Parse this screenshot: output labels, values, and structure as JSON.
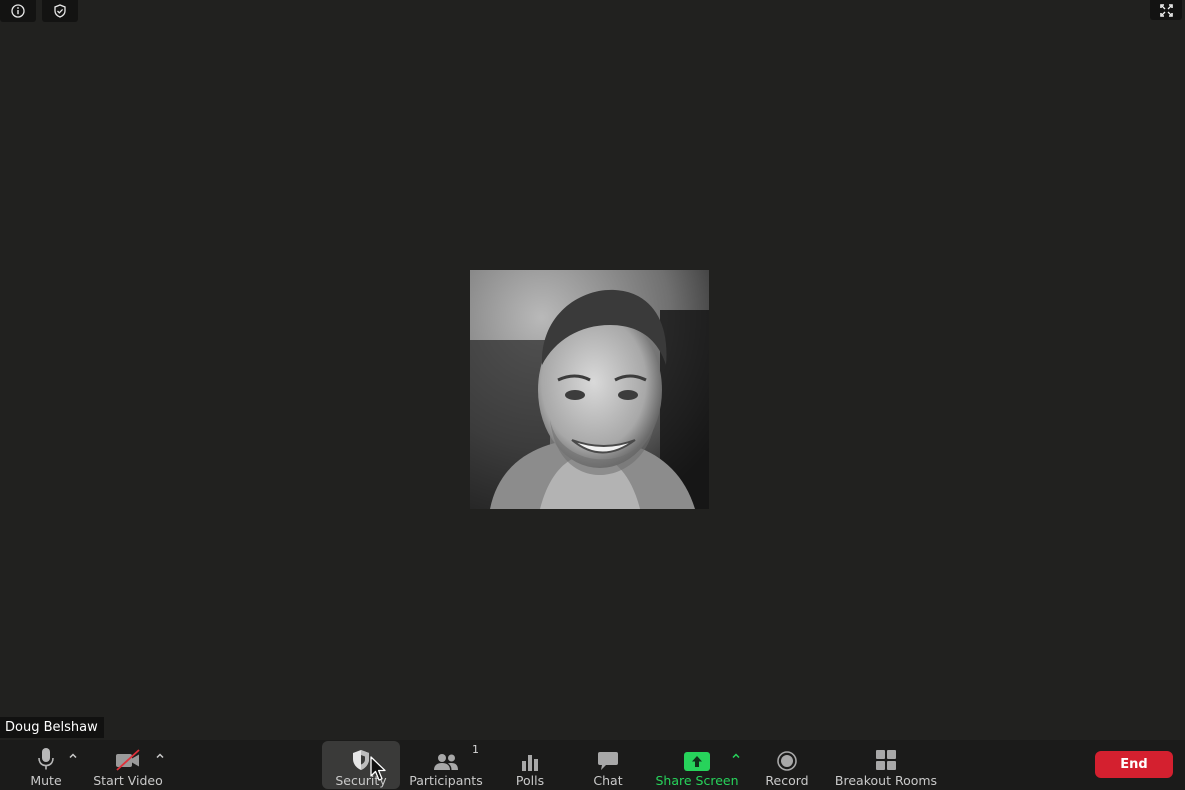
{
  "participant": {
    "name": "Doug Belshaw"
  },
  "toolbar": {
    "mute_label": "Mute",
    "video_label": "Start Video",
    "security_label": "Security",
    "participants_label": "Participants",
    "participants_count": "1",
    "polls_label": "Polls",
    "chat_label": "Chat",
    "share_label": "Share Screen",
    "record_label": "Record",
    "breakout_label": "Breakout Rooms",
    "end_label": "End"
  },
  "icons": {
    "info": "info-icon",
    "encryption": "shield-check-icon",
    "fullscreen": "fullscreen-icon",
    "mic": "microphone-icon",
    "video": "video-off-icon",
    "security": "shield-icon",
    "participants": "people-icon",
    "polls": "bar-chart-icon",
    "chat": "chat-bubble-icon",
    "share": "share-screen-icon",
    "record": "record-icon",
    "breakout": "grid-icon"
  },
  "colors": {
    "background": "#21211f",
    "toolbar": "#1b1b1a",
    "end": "#d4202f",
    "share": "#27d35b",
    "video_off_slash": "#e0303a"
  }
}
